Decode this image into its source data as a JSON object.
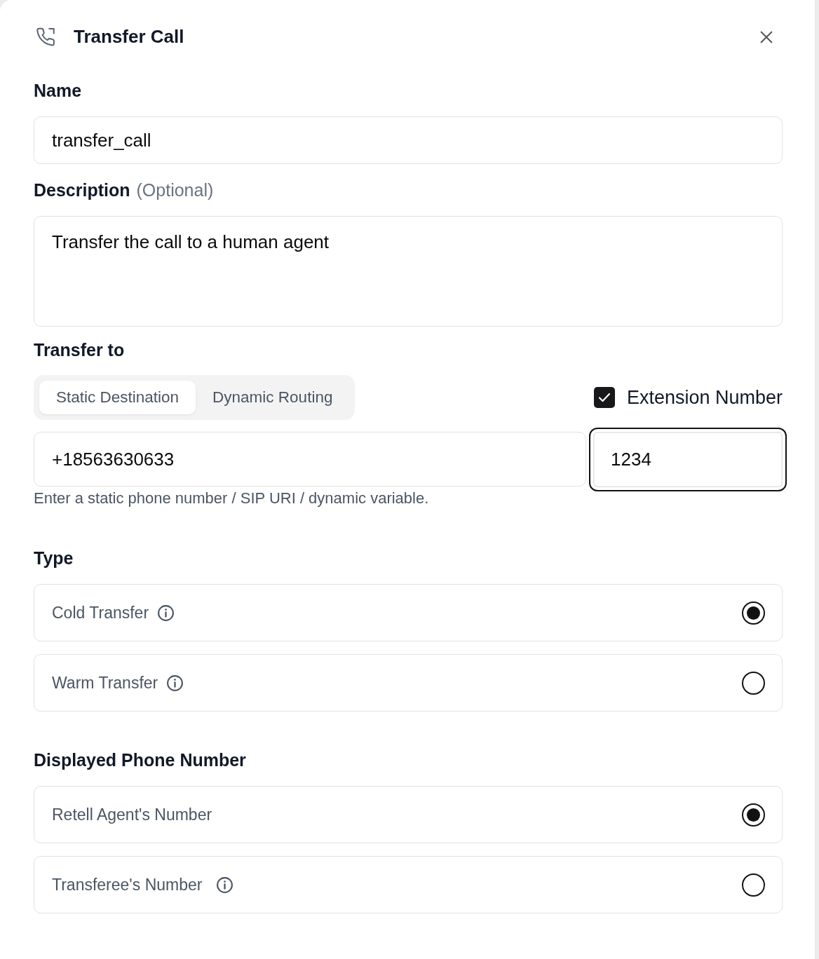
{
  "panel": {
    "title": "Transfer Call"
  },
  "name": {
    "label": "Name",
    "value": "transfer_call"
  },
  "description": {
    "label": "Description",
    "optional": "(Optional)",
    "value": "Transfer the call to a human agent"
  },
  "transfer_to": {
    "label": "Transfer to",
    "tabs": [
      {
        "label": "Static Destination",
        "selected": true
      },
      {
        "label": "Dynamic Routing",
        "selected": false
      }
    ],
    "extension": {
      "label": "Extension Number",
      "checked": true
    },
    "destination": {
      "value": "+18563630633"
    },
    "extension_field": {
      "value": "1234",
      "focused": true
    },
    "hint": "Enter a static phone number / SIP URI / dynamic variable."
  },
  "type": {
    "label": "Type",
    "options": [
      {
        "label": "Cold Transfer",
        "info": true,
        "selected": true
      },
      {
        "label": "Warm Transfer",
        "info": true,
        "selected": false
      }
    ]
  },
  "displayed_number": {
    "label": "Displayed Phone Number",
    "options": [
      {
        "label": "Retell Agent's Number",
        "info": false,
        "selected": true
      },
      {
        "label": "Transferee's Number",
        "info": true,
        "selected": false
      }
    ]
  }
}
